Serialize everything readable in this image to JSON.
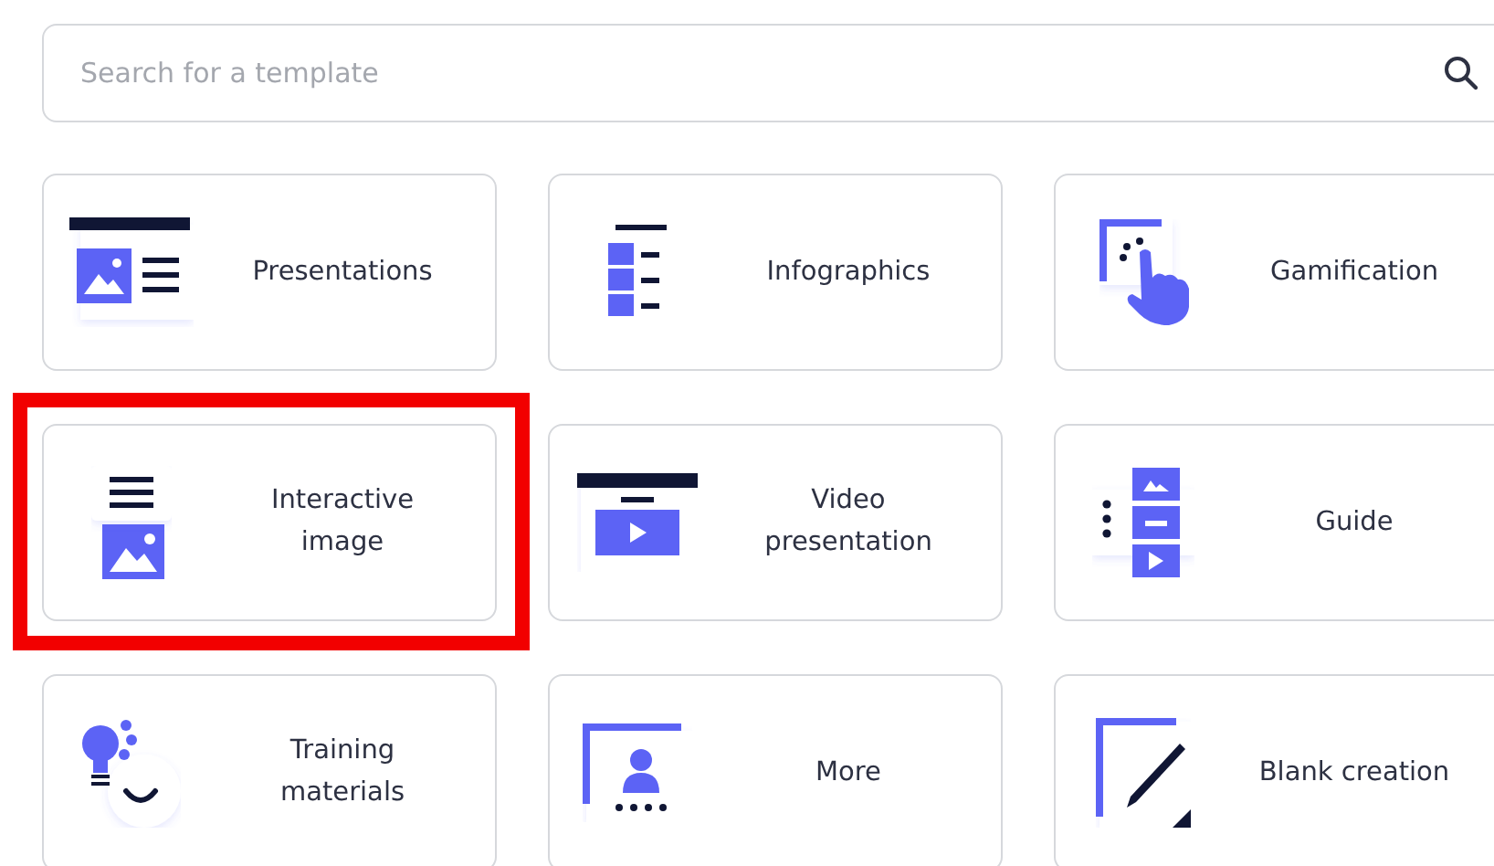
{
  "search": {
    "placeholder": "Search for a template"
  },
  "templates": [
    {
      "label": "Presentations",
      "highlighted": false
    },
    {
      "label": "Infographics",
      "highlighted": false
    },
    {
      "label": "Gamification",
      "highlighted": false
    },
    {
      "label": "Interactive\nimage",
      "highlighted": true
    },
    {
      "label": "Video\npresentation",
      "highlighted": false
    },
    {
      "label": "Guide",
      "highlighted": false
    },
    {
      "label": "Training\nmaterials",
      "highlighted": false
    },
    {
      "label": "More",
      "highlighted": false
    },
    {
      "label": "Blank creation",
      "highlighted": false
    }
  ]
}
